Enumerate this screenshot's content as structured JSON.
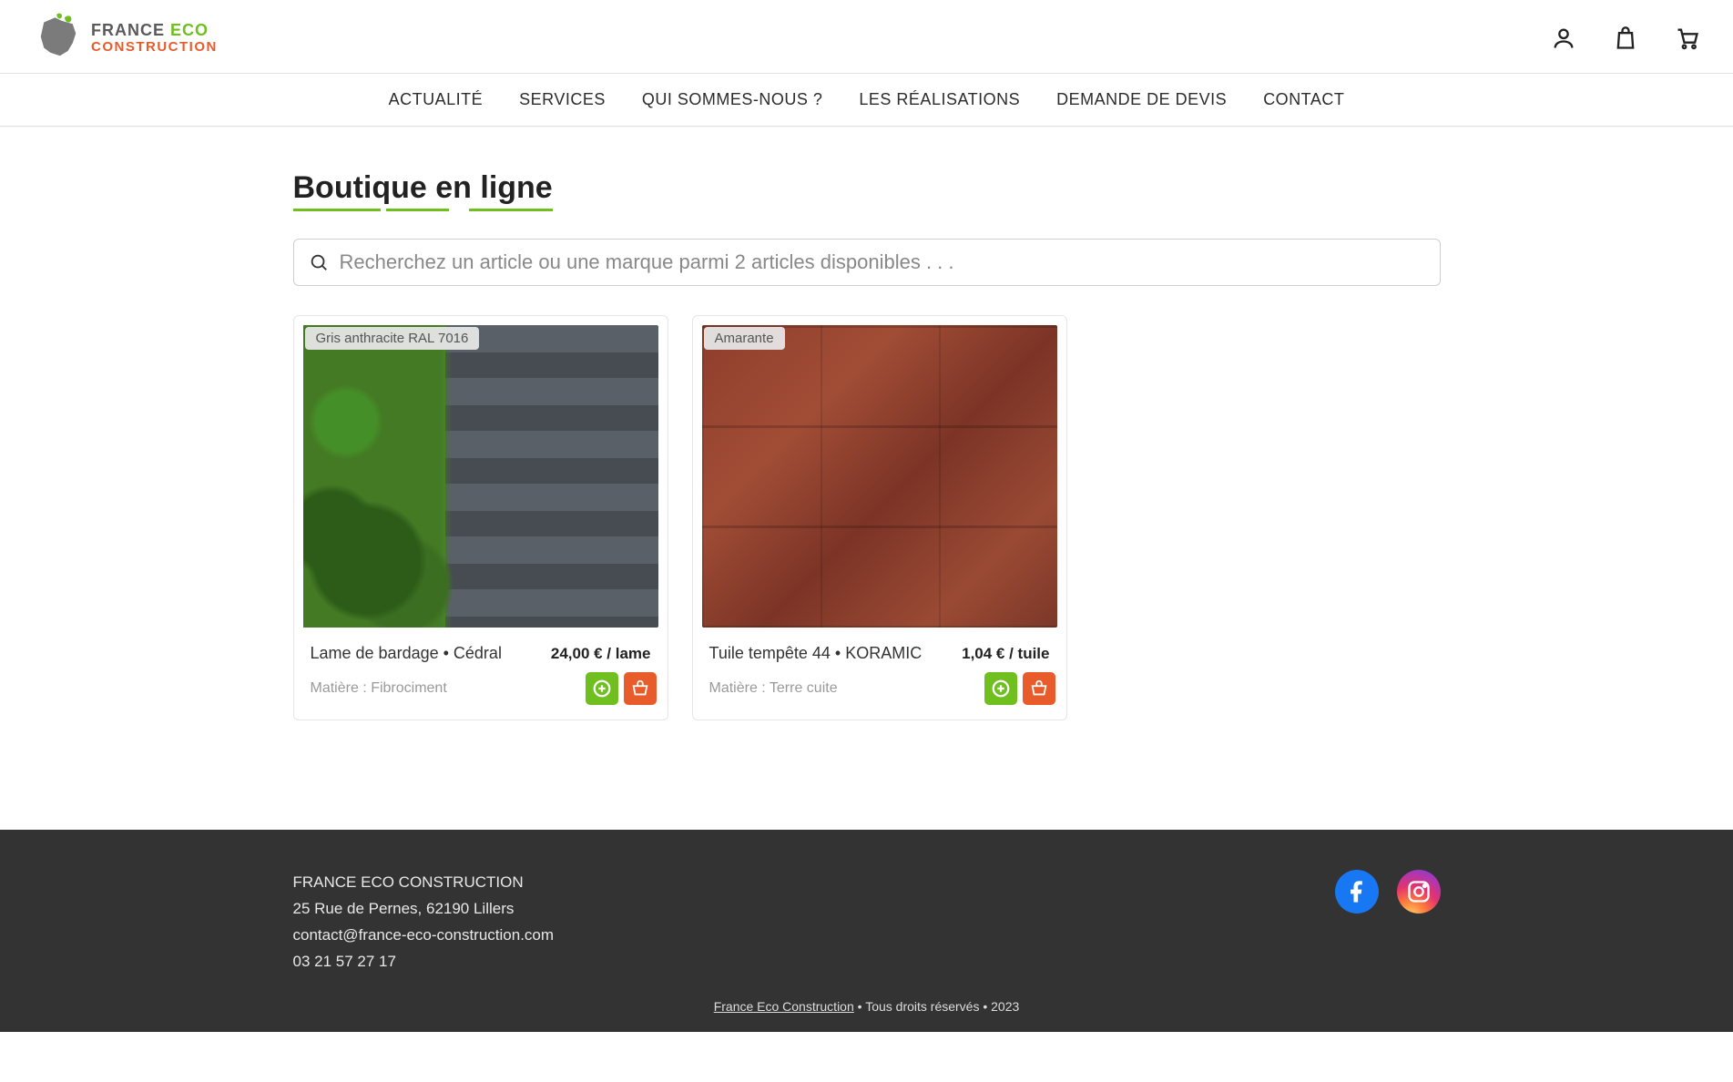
{
  "brand": {
    "line1a": "FRANCE",
    "line1b": "ECO",
    "line2": "CONSTRUCTION"
  },
  "nav": {
    "items": [
      "ACTUALITÉ",
      "SERVICES",
      "QUI SOMMES-NOUS ?",
      "LES RÉALISATIONS",
      "DEMANDE DE DEVIS",
      "CONTACT"
    ]
  },
  "page": {
    "title": "Boutique en ligne",
    "search_placeholder": "Recherchez un article ou une marque parmi 2 articles disponibles . . ."
  },
  "products": [
    {
      "badge": "Gris anthracite RAL 7016",
      "name": "Lame de bardage • Cédral",
      "price": "24,00 € / lame",
      "material": "Matière : Fibrociment",
      "thumb_class": "thumb-bardage"
    },
    {
      "badge": "Amarante",
      "name": "Tuile tempête 44 • KORAMIC",
      "price": "1,04 € / tuile",
      "material": "Matière : Terre cuite",
      "thumb_class": "thumb-tuile"
    }
  ],
  "footer": {
    "company": "FRANCE ECO CONSTRUCTION",
    "address": "25 Rue de Pernes, 62190 Lillers",
    "email": "contact@france-eco-construction.com",
    "phone": "03 21 57 27 17",
    "site": "France Eco Construction",
    "rights": " • Tous droits réservés • 2023"
  }
}
